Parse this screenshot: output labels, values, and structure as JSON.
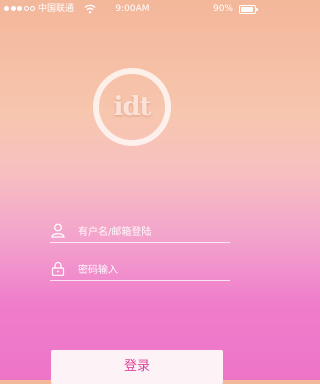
{
  "status_bar": {
    "carrier": "中国联通",
    "time": "9:00AM",
    "battery_percent": "90%",
    "battery_level": 0.9,
    "signal_bars_filled": 3,
    "signal_bars_total": 5,
    "wifi_icon": "wifi-icon"
  },
  "logo": {
    "text": "idt"
  },
  "form": {
    "username_placeholder": "有户名/邮箱登陆",
    "username_icon": "user-icon",
    "password_placeholder": "密码输入",
    "password_icon": "lock-icon",
    "login_label": "登录"
  },
  "colors": {
    "gradient_top": "#f3b79a",
    "gradient_bottom": "#ee74c8",
    "button_text": "#e0459c",
    "button_bg": "#fdf3f7"
  }
}
